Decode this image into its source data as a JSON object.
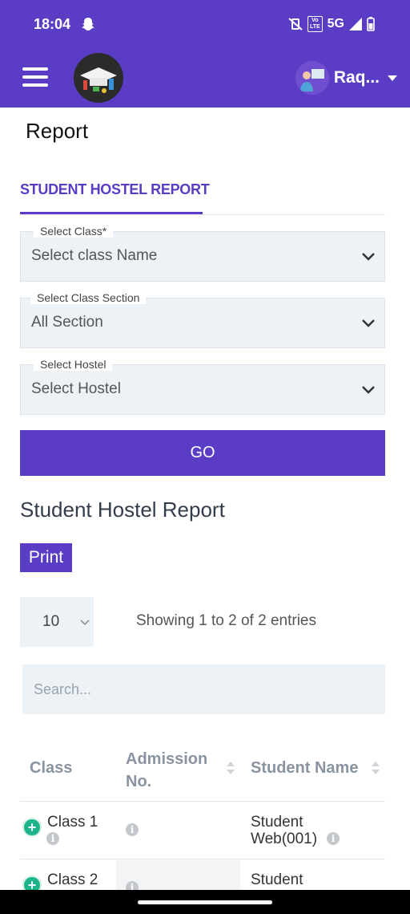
{
  "status": {
    "time": "18:04",
    "network": "5G"
  },
  "header": {
    "user_name": "Raq..."
  },
  "page": {
    "title": "Report"
  },
  "tabs": {
    "active": "STUDENT HOSTEL REPORT"
  },
  "form": {
    "class": {
      "label": "Select Class*",
      "value": "Select class Name"
    },
    "section": {
      "label": "Select Class Section",
      "value": "All Section"
    },
    "hostel": {
      "label": "Select Hostel",
      "value": "Select Hostel"
    },
    "go_label": "GO"
  },
  "report": {
    "title": "Student Hostel Report",
    "print_label": "Print",
    "page_size": "10",
    "entries_info": "Showing 1 to 2 of 2 entries",
    "search_placeholder": "Search...",
    "columns": [
      "Class",
      "Admission No.",
      "Student Name"
    ],
    "rows": [
      {
        "class": "Class 1",
        "admission_no": "",
        "student_name": "Student Web(001)"
      },
      {
        "class": "Class 2",
        "admission_no": "",
        "student_name": "Student"
      }
    ]
  },
  "colors": {
    "brand": "#5b3cc4",
    "field_bg": "#edf2f7",
    "expand": "#1cb48a"
  }
}
